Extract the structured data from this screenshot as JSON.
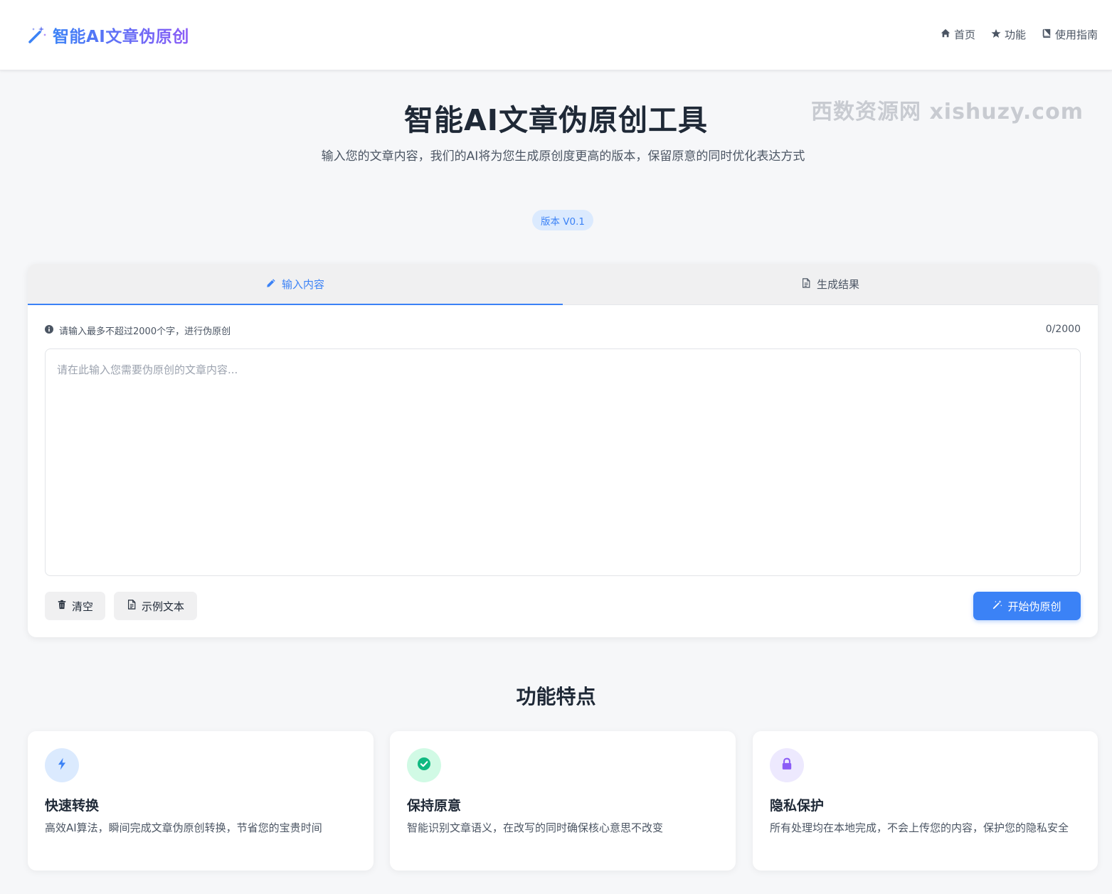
{
  "header": {
    "brand": "智能AI文章伪原创",
    "nav": [
      {
        "label": "首页",
        "icon": "home-icon"
      },
      {
        "label": "功能",
        "icon": "star-icon"
      },
      {
        "label": "使用指南",
        "icon": "book-icon"
      }
    ]
  },
  "hero": {
    "title": "智能AI文章伪原创工具",
    "description": "输入您的文章内容，我们的AI将为您生成原创度更高的版本，保留原意的同时优化表达方式",
    "version": "版本 V0.1",
    "watermark": "西数资源网  xishuzy.com"
  },
  "editor": {
    "tabs": [
      {
        "label": "输入内容",
        "icon": "pencil-icon",
        "active": true
      },
      {
        "label": "生成结果",
        "icon": "document-icon",
        "active": false
      }
    ],
    "hint": "请输入最多不超过2000个字，进行伪原创",
    "counter": "0/2000",
    "placeholder": "请在此输入您需要伪原创的文章内容...",
    "value": "",
    "buttons": {
      "clear": "清空",
      "sample": "示例文本",
      "start": "开始伪原创"
    }
  },
  "features": {
    "title": "功能特点",
    "items": [
      {
        "title": "快速转换",
        "desc": "高效AI算法，瞬间完成文章伪原创转换，节省您的宝贵时间",
        "icon": "bolt-icon",
        "color": "#3b82f6",
        "bg": "#dbeafe"
      },
      {
        "title": "保持原意",
        "desc": "智能识别文章语义，在改写的同时确保核心意思不改变",
        "icon": "check-circle-icon",
        "color": "#10b981",
        "bg": "#d1fae5"
      },
      {
        "title": "隐私保护",
        "desc": "所有处理均在本地完成，不会上传您的内容，保护您的隐私安全",
        "icon": "lock-icon",
        "color": "#8b5cf6",
        "bg": "#ede9fe"
      }
    ]
  },
  "colors": {
    "accent": "#3b82f6",
    "accent_purple": "#8b5cf6",
    "background": "#f6f7f9"
  }
}
